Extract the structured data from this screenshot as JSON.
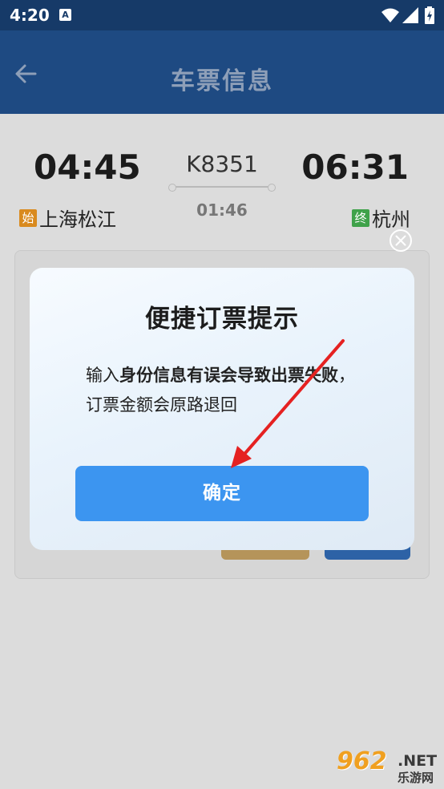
{
  "status_bar": {
    "time": "4:20",
    "notification_glyph": "A"
  },
  "header": {
    "title": "车票信息"
  },
  "trip": {
    "depart_time": "04:45",
    "arrive_time": "06:31",
    "train_number": "K8351",
    "duration": "01:46",
    "depart_badge": "始",
    "depart_station": "上海松江",
    "arrive_badge": "终",
    "arrive_station": "杭州"
  },
  "dialog": {
    "title": "便捷订票提示",
    "message_prefix": "输入",
    "message_bold_1": "身份信息有误会导致出票失败",
    "message_suffix": "，订票金额会原路退回",
    "confirm_label": "确定"
  },
  "watermark": {
    "number": "962",
    "suffix": ".NET",
    "site": "乐游网"
  },
  "colors": {
    "header": "#1e4a82",
    "status_bar": "#163a68",
    "confirm_button": "#3c95f0",
    "arrow": "#e52121"
  }
}
